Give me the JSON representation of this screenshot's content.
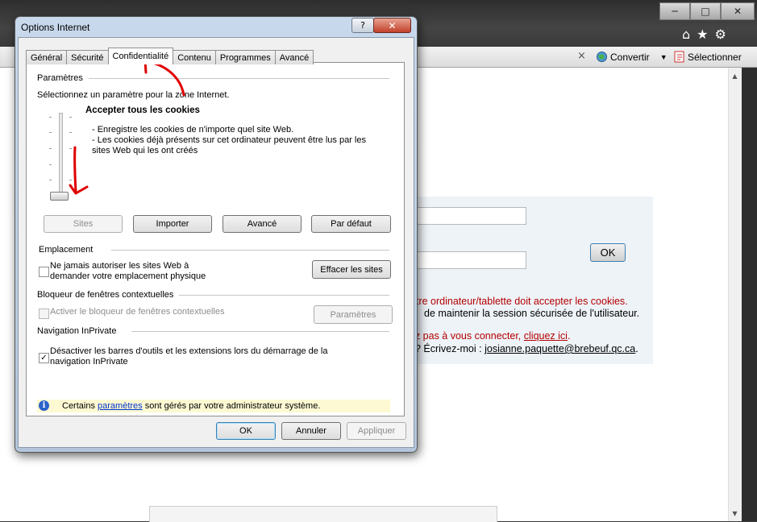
{
  "browser": {
    "window_buttons": {
      "minimize": "─",
      "maximize": "□",
      "close": "✕"
    },
    "toolbar_icons": {
      "home": "⌂",
      "favorites": "★",
      "tools": "⚙"
    },
    "command_bar": {
      "close_glyph": "×",
      "convert": "Convertir",
      "select": "Sélectionner"
    },
    "scroll": {
      "up": "▲",
      "down": "▼"
    },
    "page": {
      "ok_button": "OK",
      "line1": "tre ordinateur/tablette doit accepter les cookies.",
      "line2": "de maintenir la session sécurisée de l'utilisateur.",
      "line3_prefix": "ez pas à vous connecter, ",
      "line3_link": "cliquez ici",
      "line3_suffix": ".",
      "line4_prefix": "e? Écrivez-moi : ",
      "line4_email": "josianne.paquette@brebeuf.qc.ca",
      "line4_suffix": "."
    }
  },
  "dialog": {
    "title": "Options Internet",
    "help_glyph": "?",
    "close_glyph": "✕",
    "tabs": [
      "Général",
      "Sécurité",
      "Confidentialité",
      "Contenu",
      "Programmes",
      "Avancé"
    ],
    "active_tab": "Confidentialité",
    "settings": {
      "header": "Paramètres",
      "instruction": "Sélectionnez un paramètre pour la zone Internet.",
      "level_title": "Accepter tous les cookies",
      "level_desc1": "- Enregistre les cookies de n'importe quel site Web.",
      "level_desc2": "- Les cookies déjà présents sur cet ordinateur peuvent être lus par les",
      "level_desc3": "sites Web qui les ont créés",
      "slider_level": 0,
      "buttons": {
        "sites": "Sites",
        "import": "Importer",
        "advanced": "Avancé",
        "default": "Par défaut"
      }
    },
    "location": {
      "header": "Emplacement",
      "checkbox_line1": "Ne jamais autoriser les sites Web à",
      "checkbox_line2": "demander votre emplacement physique",
      "checked": false,
      "clear_button": "Effacer les sites"
    },
    "popup": {
      "header": "Bloqueur de fenêtres contextuelles",
      "checkbox_label": "Activer le bloqueur de fenêtres contextuelles",
      "checked": false,
      "settings_button": "Paramètres"
    },
    "inprivate": {
      "header": "Navigation InPrivate",
      "checkbox_line1": "Désactiver les barres d'outils et les extensions lors du démarrage de la",
      "checkbox_line2": "navigation InPrivate",
      "checked": true
    },
    "info": {
      "icon": "i",
      "prefix": "Certains ",
      "link": "paramètres",
      "suffix": " sont gérés par votre administrateur système."
    },
    "footer": {
      "ok": "OK",
      "cancel": "Annuler",
      "apply": "Appliquer"
    }
  },
  "colors": {
    "annotation": "#e00000",
    "accent_red_text": "#b30000",
    "link": "#0033cc"
  }
}
